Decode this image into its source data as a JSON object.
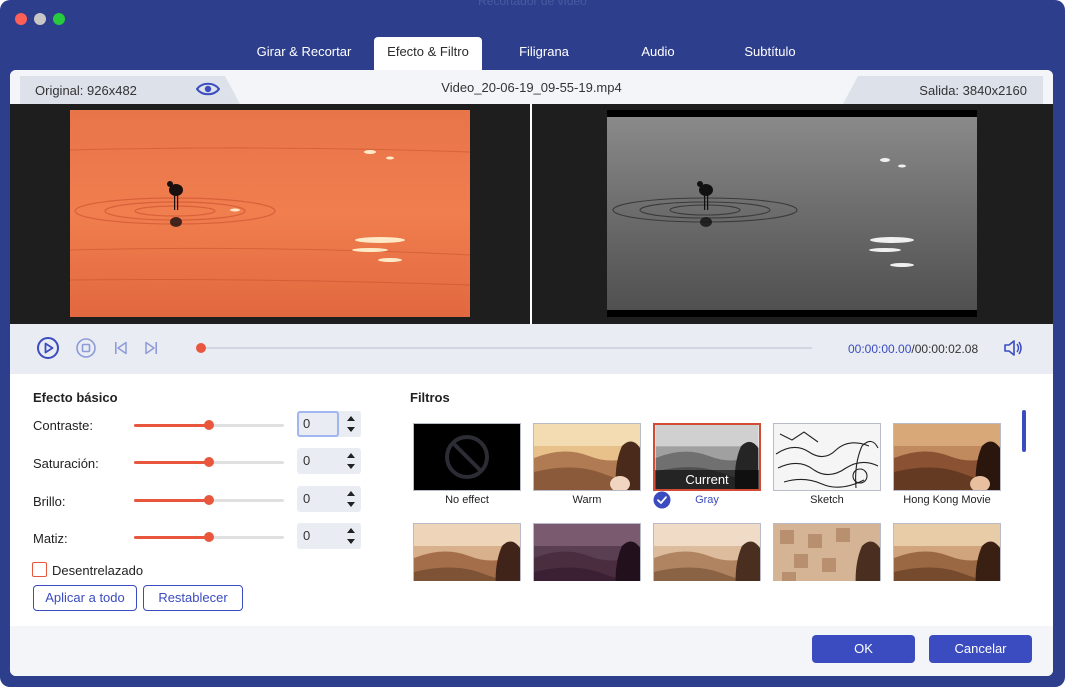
{
  "window": {
    "title": "Recortador de vídeo"
  },
  "tabs": [
    {
      "label": "Girar & Recortar"
    },
    {
      "label": "Efecto & Filtro",
      "active": true
    },
    {
      "label": "Filigrana"
    },
    {
      "label": "Audio"
    },
    {
      "label": "Subtítulo"
    }
  ],
  "info": {
    "original": "Original: 926x482",
    "filename": "Video_20-06-19_09-55-19.mp4",
    "output": "Salida: 3840x2160"
  },
  "player": {
    "current_time": "00:00:00.00",
    "total_time": "/00:00:02.08",
    "progress": 0.0
  },
  "basic_effect": {
    "title": "Efecto básico",
    "sliders": [
      {
        "label": "Contraste:",
        "value": "0",
        "level": 0.5
      },
      {
        "label": "Saturación:",
        "value": "0",
        "level": 0.5
      },
      {
        "label": "Brillo:",
        "value": "0",
        "level": 0.5
      },
      {
        "label": "Matiz:",
        "value": "0",
        "level": 0.5
      }
    ],
    "deinterlace_label": "Desentrelazado",
    "deinterlace_checked": false,
    "apply_all_label": "Aplicar a todo",
    "reset_label": "Restablecer"
  },
  "filters": {
    "title": "Filtros",
    "current_tag": "Current",
    "selected": "Gray",
    "items": [
      {
        "name": "No effect"
      },
      {
        "name": "Warm"
      },
      {
        "name": "Gray"
      },
      {
        "name": "Sketch"
      },
      {
        "name": "Hong Kong Movie"
      },
      {
        "name": ""
      },
      {
        "name": ""
      },
      {
        "name": ""
      },
      {
        "name": ""
      },
      {
        "name": ""
      }
    ]
  },
  "buttons": {
    "ok": "OK",
    "cancel": "Cancelar"
  },
  "colors": {
    "window_bg": "#2d3e8c",
    "accent": "#3a4cc0",
    "slider": "#e8573d"
  }
}
